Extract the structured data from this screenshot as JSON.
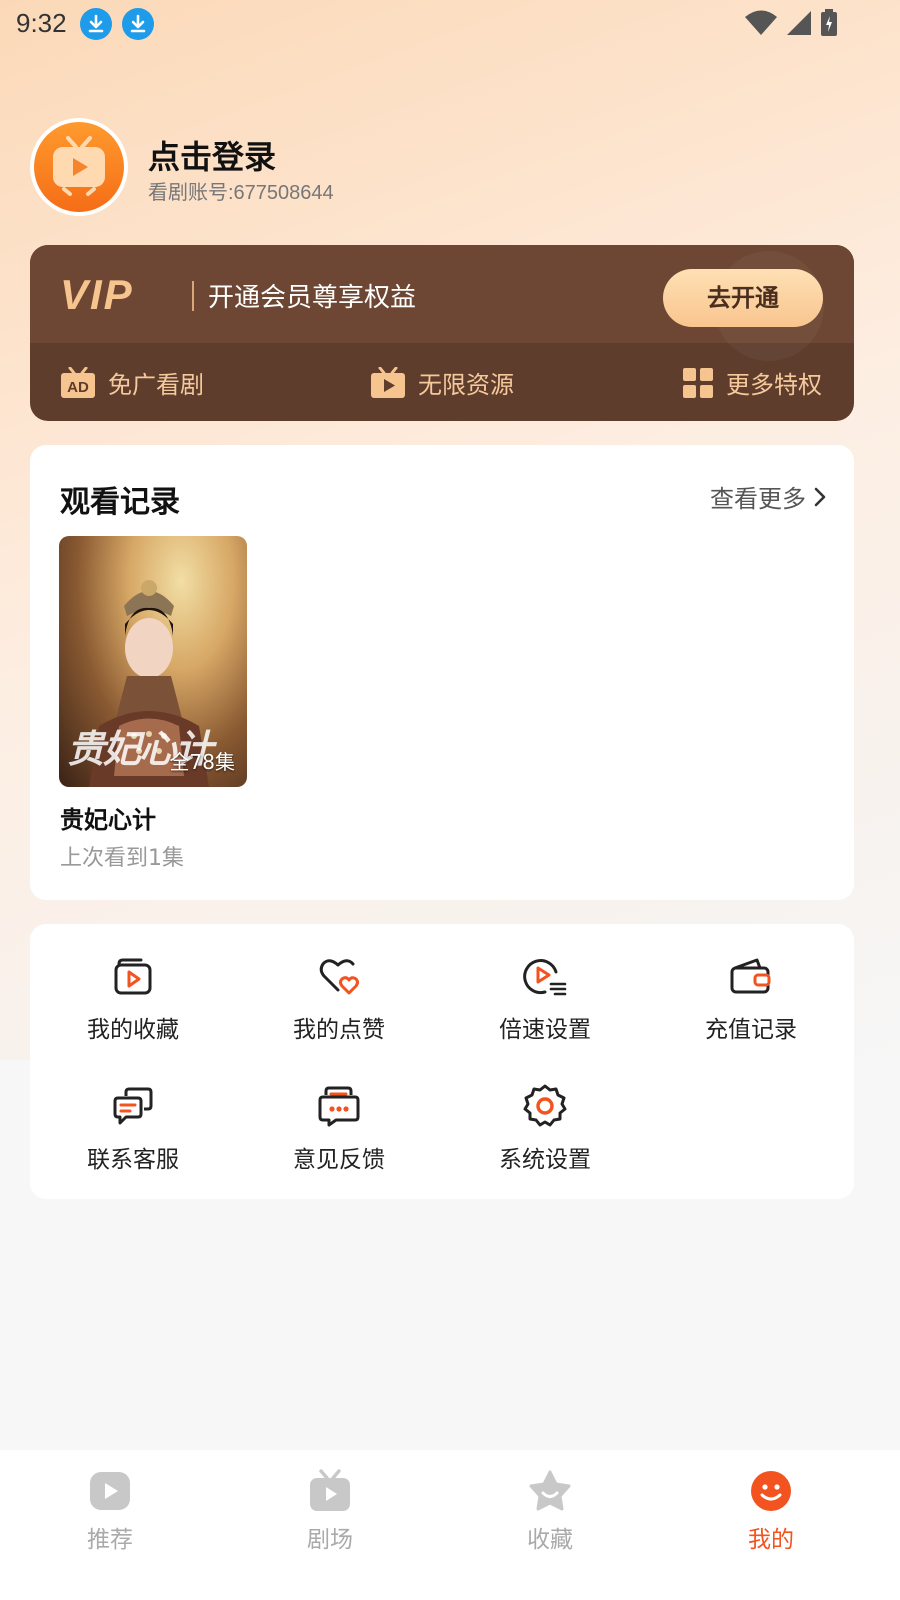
{
  "status_bar": {
    "time": "9:32"
  },
  "profile": {
    "login_text": "点击登录",
    "account_label": "看剧账号:677508644"
  },
  "vip": {
    "logo": "VIP",
    "description": "开通会员尊享权益",
    "button": "去开通",
    "perks": [
      {
        "icon": "ad-icon",
        "label": "免广看剧"
      },
      {
        "icon": "tv-icon",
        "label": "无限资源"
      },
      {
        "icon": "grid-icon",
        "label": "更多特权"
      }
    ]
  },
  "history": {
    "title": "观看记录",
    "view_more": "查看更多",
    "items": [
      {
        "title": "贵妃心计",
        "episodes": "全78集",
        "progress": "上次看到1集",
        "poster_text": "贵妃心计"
      }
    ]
  },
  "functions": [
    {
      "icon": "collection-icon",
      "label": "我的收藏"
    },
    {
      "icon": "like-icon",
      "label": "我的点赞"
    },
    {
      "icon": "speed-icon",
      "label": "倍速设置"
    },
    {
      "icon": "wallet-icon",
      "label": "充值记录"
    },
    {
      "icon": "customer-service-icon",
      "label": "联系客服"
    },
    {
      "icon": "feedback-icon",
      "label": "意见反馈"
    },
    {
      "icon": "settings-icon",
      "label": "系统设置"
    }
  ],
  "tabs": [
    {
      "icon": "play-icon",
      "label": "推荐",
      "active": false
    },
    {
      "icon": "tv-icon",
      "label": "剧场",
      "active": false
    },
    {
      "icon": "star-icon",
      "label": "收藏",
      "active": false
    },
    {
      "icon": "smile-icon",
      "label": "我的",
      "active": true
    }
  ],
  "colors": {
    "accent": "#f2531f",
    "vip_brown": "#5e3d2c",
    "vip_gold": "#f6c48f"
  }
}
